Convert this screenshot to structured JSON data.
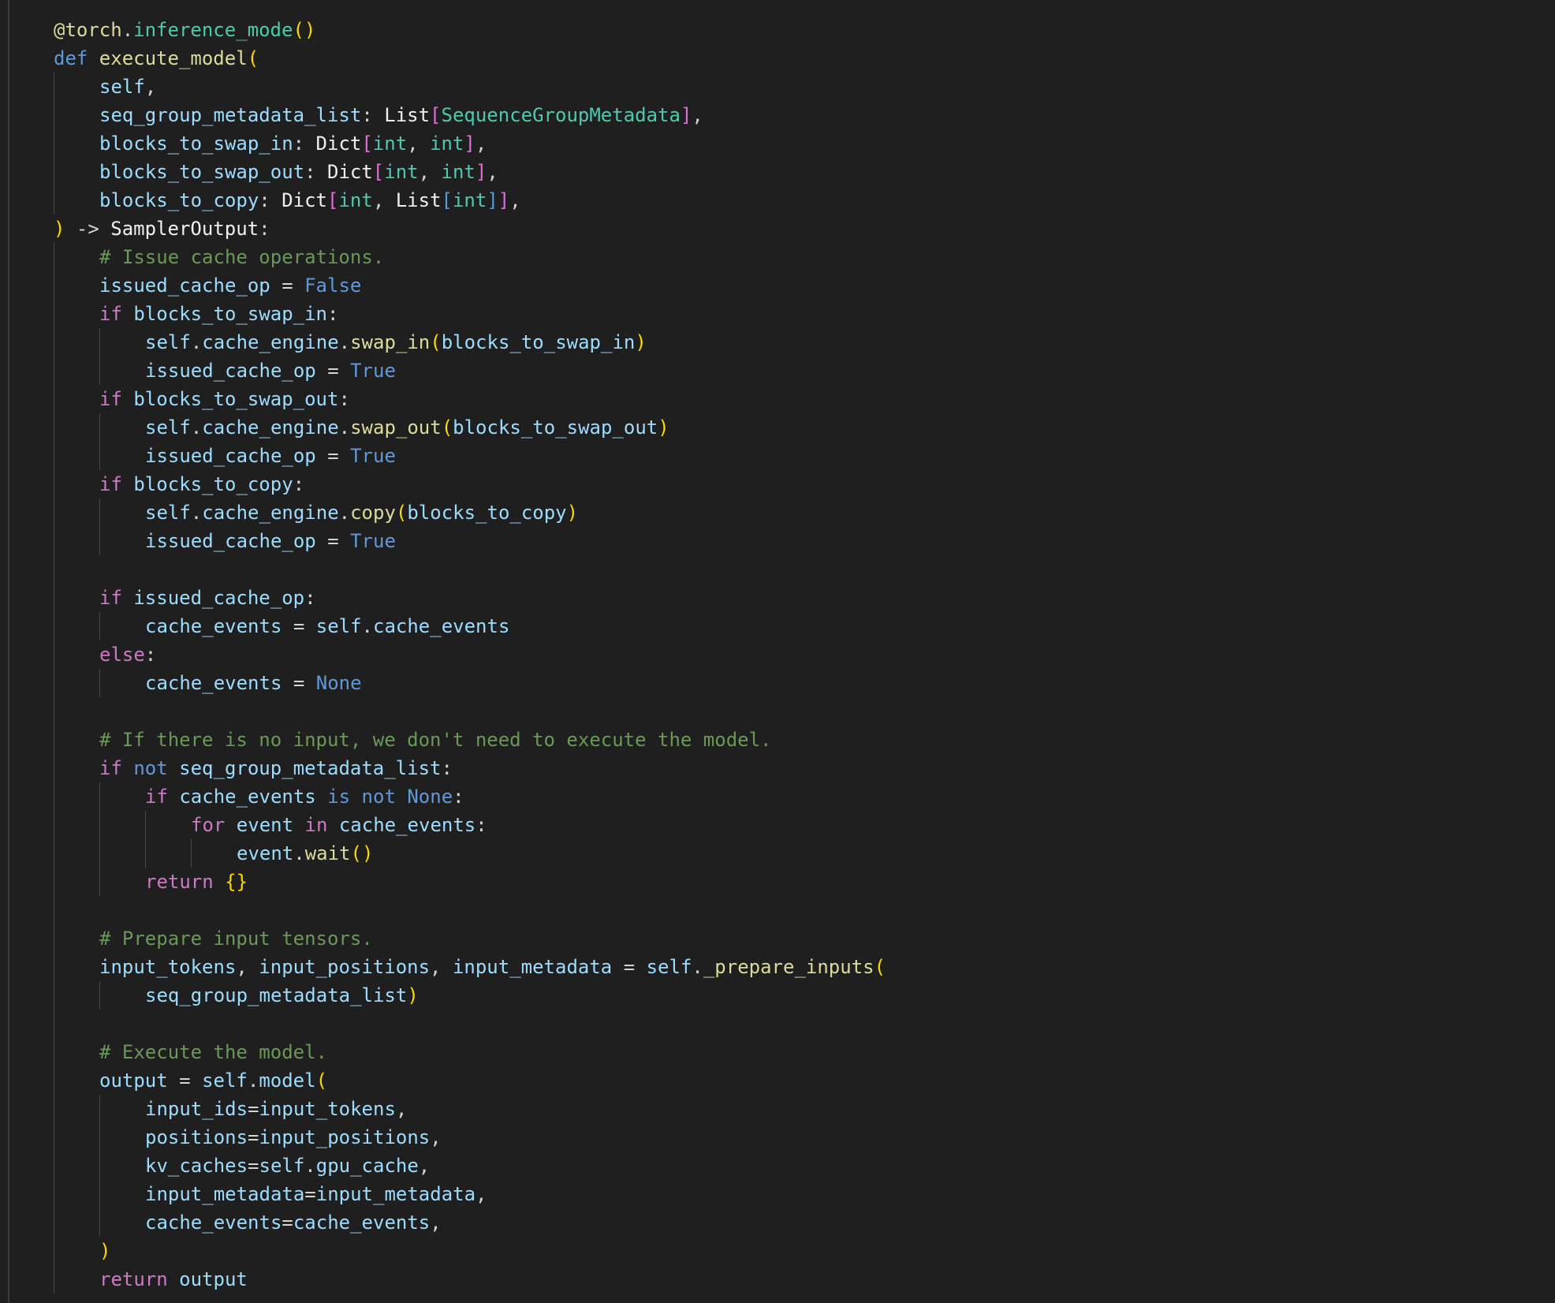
{
  "editor": {
    "language": "python",
    "lines": [
      {
        "indent": 0,
        "guides": [],
        "tokens": [
          [
            "f",
            "@torch"
          ],
          [
            "o",
            "."
          ],
          [
            "t",
            "inference_mode"
          ],
          [
            "b",
            "()"
          ]
        ]
      },
      {
        "indent": 0,
        "guides": [],
        "tokens": [
          [
            "d",
            "def "
          ],
          [
            "f",
            "execute_model"
          ],
          [
            "b",
            "("
          ]
        ]
      },
      {
        "indent": 1,
        "guides": [
          0
        ],
        "tokens": [
          [
            "v",
            "self"
          ],
          [
            "o",
            ","
          ]
        ]
      },
      {
        "indent": 1,
        "guides": [
          0
        ],
        "tokens": [
          [
            "v",
            "seq_group_metadata_list"
          ],
          [
            "o",
            ": "
          ],
          [
            "w",
            "List"
          ],
          [
            "p",
            "["
          ],
          [
            "t",
            "SequenceGroupMetadata"
          ],
          [
            "p",
            "]"
          ],
          [
            "o",
            ","
          ]
        ]
      },
      {
        "indent": 1,
        "guides": [
          0
        ],
        "tokens": [
          [
            "v",
            "blocks_to_swap_in"
          ],
          [
            "o",
            ": "
          ],
          [
            "w",
            "Dict"
          ],
          [
            "p",
            "["
          ],
          [
            "t",
            "int"
          ],
          [
            "o",
            ", "
          ],
          [
            "t",
            "int"
          ],
          [
            "p",
            "]"
          ],
          [
            "o",
            ","
          ]
        ]
      },
      {
        "indent": 1,
        "guides": [
          0
        ],
        "tokens": [
          [
            "v",
            "blocks_to_swap_out"
          ],
          [
            "o",
            ": "
          ],
          [
            "w",
            "Dict"
          ],
          [
            "p",
            "["
          ],
          [
            "t",
            "int"
          ],
          [
            "o",
            ", "
          ],
          [
            "t",
            "int"
          ],
          [
            "p",
            "]"
          ],
          [
            "o",
            ","
          ]
        ]
      },
      {
        "indent": 1,
        "guides": [
          0
        ],
        "tokens": [
          [
            "v",
            "blocks_to_copy"
          ],
          [
            "o",
            ": "
          ],
          [
            "w",
            "Dict"
          ],
          [
            "p",
            "["
          ],
          [
            "t",
            "int"
          ],
          [
            "o",
            ", "
          ],
          [
            "w",
            "List"
          ],
          [
            "s",
            "["
          ],
          [
            "t",
            "int"
          ],
          [
            "s",
            "]"
          ],
          [
            "p",
            "]"
          ],
          [
            "o",
            ","
          ]
        ]
      },
      {
        "indent": 0,
        "guides": [],
        "tokens": [
          [
            "b",
            ")"
          ],
          [
            "o",
            " -> "
          ],
          [
            "w",
            "SamplerOutput"
          ],
          [
            "o",
            ":"
          ]
        ]
      },
      {
        "indent": 1,
        "guides": [
          0
        ],
        "tokens": [
          [
            "c",
            "# Issue cache operations."
          ]
        ]
      },
      {
        "indent": 1,
        "guides": [
          0
        ],
        "tokens": [
          [
            "v",
            "issued_cache_op"
          ],
          [
            "o",
            " = "
          ],
          [
            "d",
            "False"
          ]
        ]
      },
      {
        "indent": 1,
        "guides": [
          0
        ],
        "tokens": [
          [
            "k",
            "if "
          ],
          [
            "v",
            "blocks_to_swap_in"
          ],
          [
            "o",
            ":"
          ]
        ]
      },
      {
        "indent": 2,
        "guides": [
          0,
          1
        ],
        "tokens": [
          [
            "v",
            "self"
          ],
          [
            "o",
            "."
          ],
          [
            "v",
            "cache_engine"
          ],
          [
            "o",
            "."
          ],
          [
            "f",
            "swap_in"
          ],
          [
            "b",
            "("
          ],
          [
            "v",
            "blocks_to_swap_in"
          ],
          [
            "b",
            ")"
          ]
        ]
      },
      {
        "indent": 2,
        "guides": [
          0,
          1
        ],
        "tokens": [
          [
            "v",
            "issued_cache_op"
          ],
          [
            "o",
            " = "
          ],
          [
            "d",
            "True"
          ]
        ]
      },
      {
        "indent": 1,
        "guides": [
          0
        ],
        "tokens": [
          [
            "k",
            "if "
          ],
          [
            "v",
            "blocks_to_swap_out"
          ],
          [
            "o",
            ":"
          ]
        ]
      },
      {
        "indent": 2,
        "guides": [
          0,
          1
        ],
        "tokens": [
          [
            "v",
            "self"
          ],
          [
            "o",
            "."
          ],
          [
            "v",
            "cache_engine"
          ],
          [
            "o",
            "."
          ],
          [
            "f",
            "swap_out"
          ],
          [
            "b",
            "("
          ],
          [
            "v",
            "blocks_to_swap_out"
          ],
          [
            "b",
            ")"
          ]
        ]
      },
      {
        "indent": 2,
        "guides": [
          0,
          1
        ],
        "tokens": [
          [
            "v",
            "issued_cache_op"
          ],
          [
            "o",
            " = "
          ],
          [
            "d",
            "True"
          ]
        ]
      },
      {
        "indent": 1,
        "guides": [
          0
        ],
        "tokens": [
          [
            "k",
            "if "
          ],
          [
            "v",
            "blocks_to_copy"
          ],
          [
            "o",
            ":"
          ]
        ]
      },
      {
        "indent": 2,
        "guides": [
          0,
          1
        ],
        "tokens": [
          [
            "v",
            "self"
          ],
          [
            "o",
            "."
          ],
          [
            "v",
            "cache_engine"
          ],
          [
            "o",
            "."
          ],
          [
            "f",
            "copy"
          ],
          [
            "b",
            "("
          ],
          [
            "v",
            "blocks_to_copy"
          ],
          [
            "b",
            ")"
          ]
        ]
      },
      {
        "indent": 2,
        "guides": [
          0,
          1
        ],
        "tokens": [
          [
            "v",
            "issued_cache_op"
          ],
          [
            "o",
            " = "
          ],
          [
            "d",
            "True"
          ]
        ]
      },
      {
        "indent": 1,
        "guides": [
          0
        ],
        "tokens": []
      },
      {
        "indent": 1,
        "guides": [
          0
        ],
        "tokens": [
          [
            "k",
            "if "
          ],
          [
            "v",
            "issued_cache_op"
          ],
          [
            "o",
            ":"
          ]
        ]
      },
      {
        "indent": 2,
        "guides": [
          0,
          1
        ],
        "tokens": [
          [
            "v",
            "cache_events"
          ],
          [
            "o",
            " = "
          ],
          [
            "v",
            "self"
          ],
          [
            "o",
            "."
          ],
          [
            "v",
            "cache_events"
          ]
        ]
      },
      {
        "indent": 1,
        "guides": [
          0
        ],
        "tokens": [
          [
            "k",
            "else"
          ],
          [
            "o",
            ":"
          ]
        ]
      },
      {
        "indent": 2,
        "guides": [
          0,
          1
        ],
        "tokens": [
          [
            "v",
            "cache_events"
          ],
          [
            "o",
            " = "
          ],
          [
            "d",
            "None"
          ]
        ]
      },
      {
        "indent": 1,
        "guides": [
          0
        ],
        "tokens": []
      },
      {
        "indent": 1,
        "guides": [
          0
        ],
        "tokens": [
          [
            "c",
            "# If there is no input, we don't need to execute the model."
          ]
        ]
      },
      {
        "indent": 1,
        "guides": [
          0
        ],
        "tokens": [
          [
            "k",
            "if "
          ],
          [
            "d",
            "not "
          ],
          [
            "v",
            "seq_group_metadata_list"
          ],
          [
            "o",
            ":"
          ]
        ]
      },
      {
        "indent": 2,
        "guides": [
          0,
          1
        ],
        "tokens": [
          [
            "k",
            "if "
          ],
          [
            "v",
            "cache_events"
          ],
          [
            "d",
            " is not "
          ],
          [
            "d",
            "None"
          ],
          [
            "o",
            ":"
          ]
        ]
      },
      {
        "indent": 3,
        "guides": [
          0,
          1,
          2
        ],
        "tokens": [
          [
            "k",
            "for "
          ],
          [
            "v",
            "event"
          ],
          [
            "k",
            " in "
          ],
          [
            "v",
            "cache_events"
          ],
          [
            "o",
            ":"
          ]
        ]
      },
      {
        "indent": 4,
        "guides": [
          0,
          1,
          2,
          3
        ],
        "tokens": [
          [
            "v",
            "event"
          ],
          [
            "o",
            "."
          ],
          [
            "f",
            "wait"
          ],
          [
            "b",
            "()"
          ]
        ]
      },
      {
        "indent": 2,
        "guides": [
          0,
          1
        ],
        "tokens": [
          [
            "k",
            "return "
          ],
          [
            "b",
            "{}"
          ]
        ]
      },
      {
        "indent": 1,
        "guides": [
          0
        ],
        "tokens": []
      },
      {
        "indent": 1,
        "guides": [
          0
        ],
        "tokens": [
          [
            "c",
            "# Prepare input tensors."
          ]
        ]
      },
      {
        "indent": 1,
        "guides": [
          0
        ],
        "tokens": [
          [
            "v",
            "input_tokens"
          ],
          [
            "o",
            ", "
          ],
          [
            "v",
            "input_positions"
          ],
          [
            "o",
            ", "
          ],
          [
            "v",
            "input_metadata"
          ],
          [
            "o",
            " = "
          ],
          [
            "v",
            "self"
          ],
          [
            "o",
            "."
          ],
          [
            "f",
            "_prepare_inputs"
          ],
          [
            "b",
            "("
          ]
        ]
      },
      {
        "indent": 2,
        "guides": [
          0,
          1
        ],
        "tokens": [
          [
            "v",
            "seq_group_metadata_list"
          ],
          [
            "b",
            ")"
          ]
        ]
      },
      {
        "indent": 1,
        "guides": [
          0
        ],
        "tokens": []
      },
      {
        "indent": 1,
        "guides": [
          0
        ],
        "tokens": [
          [
            "c",
            "# Execute the model."
          ]
        ]
      },
      {
        "indent": 1,
        "guides": [
          0
        ],
        "tokens": [
          [
            "v",
            "output"
          ],
          [
            "o",
            " = "
          ],
          [
            "v",
            "self"
          ],
          [
            "o",
            "."
          ],
          [
            "v",
            "model"
          ],
          [
            "b",
            "("
          ]
        ]
      },
      {
        "indent": 2,
        "guides": [
          0,
          1
        ],
        "tokens": [
          [
            "v",
            "input_ids"
          ],
          [
            "o",
            "="
          ],
          [
            "v",
            "input_tokens"
          ],
          [
            "o",
            ","
          ]
        ]
      },
      {
        "indent": 2,
        "guides": [
          0,
          1
        ],
        "tokens": [
          [
            "v",
            "positions"
          ],
          [
            "o",
            "="
          ],
          [
            "v",
            "input_positions"
          ],
          [
            "o",
            ","
          ]
        ]
      },
      {
        "indent": 2,
        "guides": [
          0,
          1
        ],
        "tokens": [
          [
            "v",
            "kv_caches"
          ],
          [
            "o",
            "="
          ],
          [
            "v",
            "self"
          ],
          [
            "o",
            "."
          ],
          [
            "v",
            "gpu_cache"
          ],
          [
            "o",
            ","
          ]
        ]
      },
      {
        "indent": 2,
        "guides": [
          0,
          1
        ],
        "tokens": [
          [
            "v",
            "input_metadata"
          ],
          [
            "o",
            "="
          ],
          [
            "v",
            "input_metadata"
          ],
          [
            "o",
            ","
          ]
        ]
      },
      {
        "indent": 2,
        "guides": [
          0,
          1
        ],
        "tokens": [
          [
            "v",
            "cache_events"
          ],
          [
            "o",
            "="
          ],
          [
            "v",
            "cache_events"
          ],
          [
            "o",
            ","
          ]
        ]
      },
      {
        "indent": 1,
        "guides": [
          0
        ],
        "tokens": [
          [
            "b",
            ")"
          ]
        ]
      },
      {
        "indent": 1,
        "guides": [
          0
        ],
        "tokens": [
          [
            "k",
            "return "
          ],
          [
            "v",
            "output"
          ]
        ]
      }
    ]
  },
  "colors": {
    "background": "#1f1f1f",
    "keyword": "#cd79c7",
    "constant": "#5f99da",
    "function": "#dbdb9b",
    "comment": "#6a9955",
    "type": "#4ec9b0",
    "variable": "#9cdcfe",
    "bracket1": "#ffd700",
    "bracket2": "#da70d6",
    "bracket3": "#569cd6"
  }
}
